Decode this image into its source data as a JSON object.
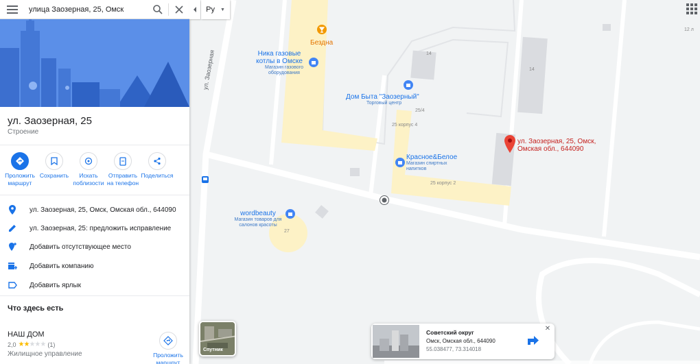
{
  "search": {
    "query": "улица Заозерная, 25, Омск"
  },
  "language": {
    "label": "Ру"
  },
  "place": {
    "title": "ул. Заозерная, 25",
    "subtitle": "Строение"
  },
  "actions": [
    {
      "label": "Проложить маршрут",
      "icon": "directions-icon"
    },
    {
      "label": "Сохранить",
      "icon": "bookmark-icon"
    },
    {
      "label": "Искать поблизости",
      "icon": "nearby-icon"
    },
    {
      "label": "Отправить на телефон",
      "icon": "send-to-phone-icon"
    },
    {
      "label": "Поделиться",
      "icon": "share-icon"
    }
  ],
  "info_rows": [
    {
      "text": "ул. Заозерная, 25, Омск, Омская обл., 644090",
      "icon": "location-pin-icon"
    },
    {
      "text": "ул. Заозерная, 25: предложить исправление",
      "icon": "edit-pencil-icon"
    },
    {
      "text": "Добавить отсутствующее место",
      "icon": "add-place-icon"
    },
    {
      "text": "Добавить компанию",
      "icon": "add-business-icon"
    },
    {
      "text": "Добавить ярлык",
      "icon": "label-icon"
    }
  ],
  "nearby": {
    "section_title": "Что здесь есть",
    "name": "НАШ ДОМ",
    "rating": "2,0",
    "rating_value": 2,
    "reviews": "(1)",
    "type": "Жилищное управление",
    "route_label": "Проложить маршрут"
  },
  "map": {
    "street": "ул. Заозерная",
    "pin_label": "ул. Заозерная, 25, Омск, Омская обл., 644090",
    "pois": {
      "bezdna": "Бездна",
      "nika": "Ника газовые котлы в Омске",
      "nika_sub": "Магазин газового оборудования",
      "dom_byta": "Дом Быта \"Заозерный\"",
      "dom_byta_sub": "Торговый центр",
      "krasnoe": "Красное&Белое",
      "krasnoe_sub": "Магазин спиртных напитков",
      "wordbeauty": "wordbeauty",
      "wordbeauty_sub": "Магазин товаров для салонов красоты"
    },
    "building_numbers": {
      "n14a": "14",
      "n14b": "14",
      "n254": "25/4",
      "n25k4": "25 корпус 4",
      "n25k2": "25 корпус 2",
      "n27": "27",
      "n12": "12 л"
    }
  },
  "satellite": {
    "label": "Спутник"
  },
  "card": {
    "title": "Советский округ",
    "address": "Омск, Омская обл., 644090",
    "coords": "55.038477, 73.314018"
  },
  "colors": {
    "accent": "#1a73e8",
    "pin": "#ea4335",
    "star": "#fbbc04",
    "building_yellow": "#fdf2c6"
  }
}
